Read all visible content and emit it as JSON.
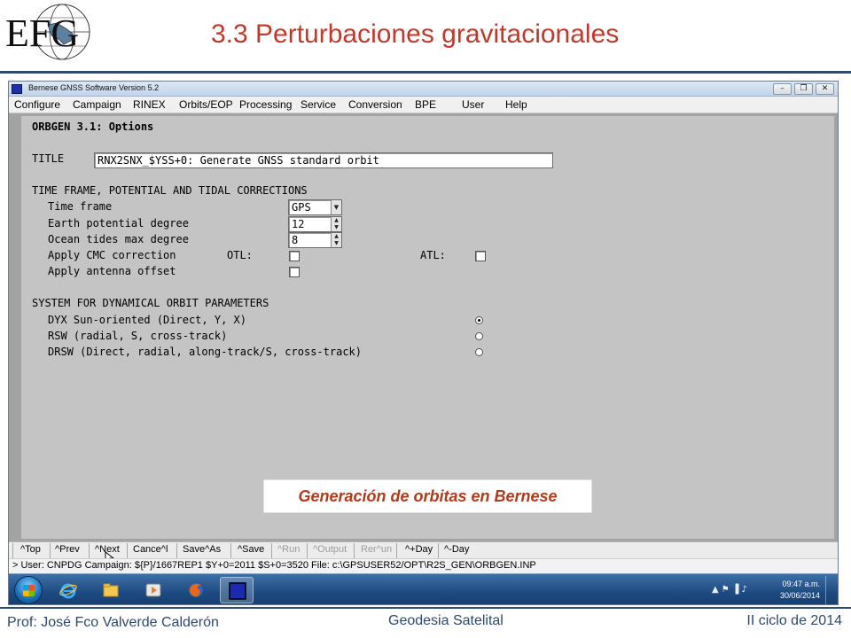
{
  "slide": {
    "title": "3.3 Perturbaciones gravitacionales",
    "logo_text": "EFG",
    "caption": "Generación de orbitas en Bernese",
    "footer_left": "Prof: José Fco Valverde Calderón",
    "footer_center": "Geodesia Satelital",
    "footer_right": "II ciclo de 2014"
  },
  "window": {
    "title": "Bernese GNSS Software Version 5.2",
    "controls": [
      "minimize-icon",
      "restore-icon",
      "close-icon"
    ]
  },
  "menu": [
    "Configure",
    "Campaign",
    "RINEX",
    "Orbits/EOP",
    "Processing",
    "Service",
    "Conversion",
    "BPE",
    "User",
    "Help"
  ],
  "form": {
    "heading": "ORBGEN 3.1: Options",
    "title_label": "TITLE",
    "title_value": "RNX2SNX_$YSS+0: Generate GNSS standard orbit",
    "section1": "TIME FRAME, POTENTIAL AND TIDAL CORRECTIONS",
    "time_frame_label": "Time frame",
    "time_frame_value": "GPS",
    "earth_potential_label": "Earth potential degree",
    "earth_potential_value": "12",
    "ocean_tides_label": "Ocean tides max degree",
    "ocean_tides_value": "8",
    "cmc_label": "Apply CMC correction",
    "otl_label": "OTL:",
    "otl_checked": false,
    "atl_label": "ATL:",
    "atl_checked": false,
    "antenna_offset_label": "Apply antenna offset",
    "antenna_offset_checked": false,
    "section2": "SYSTEM FOR DYNAMICAL ORBIT PARAMETERS",
    "options": [
      {
        "label": "DYX Sun-oriented (Direct, Y, X)",
        "selected": true
      },
      {
        "label": "RSW (radial, S, cross-track)",
        "selected": false
      },
      {
        "label": "DRSW (Direct, radial, along-track/S, cross-track)",
        "selected": false
      }
    ]
  },
  "toolbar": {
    "buttons": [
      {
        "label": "^Top",
        "enabled": true
      },
      {
        "label": "^Prev",
        "enabled": true
      },
      {
        "label": "^Next",
        "enabled": true
      },
      {
        "label": "Cance^l",
        "enabled": true
      },
      {
        "label": "Save^As",
        "enabled": true
      },
      {
        "label": "^Save",
        "enabled": true
      },
      {
        "label": "^Run",
        "enabled": false
      },
      {
        "label": "^Output",
        "enabled": false
      },
      {
        "label": "Rer^un",
        "enabled": false
      },
      {
        "label": "^+Day",
        "enabled": true
      },
      {
        "label": "^-Day",
        "enabled": true
      }
    ]
  },
  "status": "> User: CNPDG  Campaign: ${P}/1667REP1  $Y+0=2011  $S+0=3520   File: c:\\GPSUSER52/OPT\\R2S_GEN\\ORBGEN.INP",
  "taskbar": {
    "apps": [
      "internet-explorer-icon",
      "file-explorer-icon",
      "media-player-icon",
      "firefox-icon",
      "bernese-icon"
    ],
    "time": "09:47 a.m.",
    "date": "30/06/2014"
  },
  "colors": {
    "title_red": "#c0392b",
    "rule_blue": "#2e4a6e",
    "caption_text": "#b03a1e",
    "form_bg": "#c4c4c4",
    "taskbar": "#1c4a80"
  }
}
